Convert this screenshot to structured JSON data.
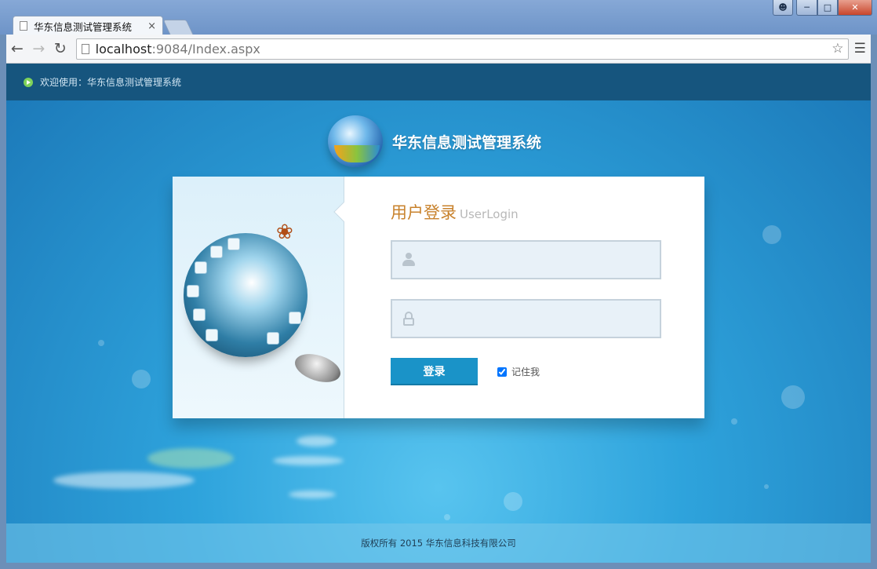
{
  "browser": {
    "tab_title": "华东信息测试管理系统",
    "tab_close": "×",
    "url_host": "localhost",
    "url_rest": ":9084/Index.aspx"
  },
  "page": {
    "welcome_text": "欢迎使用：华东信息测试管理系统",
    "brand_title": "华东信息测试管理系统",
    "login": {
      "heading_cn": "用户登录",
      "heading_en": "UserLogin",
      "username_value": "",
      "password_value": "",
      "submit_label": "登录",
      "remember_label": "记住我",
      "remember_checked": true
    },
    "footer_text": "版权所有 2015 华东信息科技有限公司"
  },
  "colors": {
    "accent": "#1a93c8",
    "heading": "#c8822c",
    "header_bar": "#16557e"
  }
}
